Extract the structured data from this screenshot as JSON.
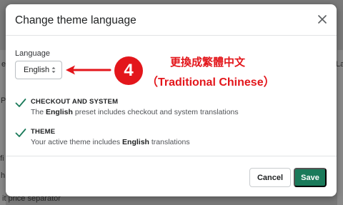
{
  "background": {
    "fragments": [
      "e",
      "P",
      "ofi",
      "h",
      "it price separator",
      "La"
    ]
  },
  "modal": {
    "title": "Change theme language",
    "close_icon": "close-icon",
    "language": {
      "label": "Language",
      "selected": "English",
      "icon": "chevron-updown-icon"
    },
    "items": [
      {
        "title": "CHECKOUT AND SYSTEM",
        "desc_pre": "The ",
        "desc_bold": "English",
        "desc_post": " preset includes checkout and system translations"
      },
      {
        "title": "THEME",
        "desc_pre": "Your active theme includes ",
        "desc_bold": "English",
        "desc_post": " translations"
      }
    ],
    "footer": {
      "cancel_label": "Cancel",
      "save_label": "Save"
    }
  },
  "annotation": {
    "step": "4",
    "line1": "更換成繁體中文",
    "line2": "（Traditional Chinese）"
  },
  "colors": {
    "primary": "#1a7a5a",
    "check": "#1a7a5a",
    "annotation": "#e3161b"
  }
}
